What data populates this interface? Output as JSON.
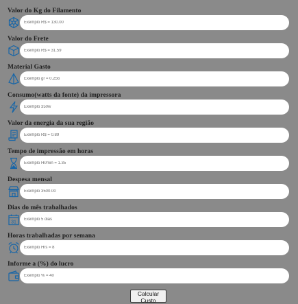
{
  "fields": [
    {
      "label": "Valor do Kg do Filamento",
      "placeholder": "Exemplo R$ = 130.00",
      "icon": "cube-network-icon"
    },
    {
      "label": "Valor do Frete",
      "placeholder": "Exemplo R$ = 31.59",
      "icon": "box-icon"
    },
    {
      "label": "Material Gasto",
      "placeholder": "Exemplo gr = 0.256",
      "icon": "pyramid-icon"
    },
    {
      "label": "Consumo(watts da fonte) da impressora",
      "placeholder": "Exemplo 350w",
      "icon": "lightning-icon"
    },
    {
      "label": "Valor da energia da sua região",
      "placeholder": "Exemplo R$ = 0.89",
      "icon": "bill-icon"
    },
    {
      "label": "Tempo de impressão em horas",
      "placeholder": "Exemplo Hr/min = 1.35",
      "icon": "hourglass-icon"
    },
    {
      "label": "Despesa mensal",
      "placeholder": "Exemplo 3500.00",
      "icon": "store-icon"
    },
    {
      "label": "Dias do mês trabalhados",
      "placeholder": "Exemplo 5 dias",
      "icon": "calendar-icon"
    },
    {
      "label": "Horas trabalhadas por semana",
      "placeholder": "Exemplo Hrs = 8",
      "icon": "alarm-clock-icon"
    },
    {
      "label": "Informe a (%) do lucro",
      "placeholder": "Exemplo % = 40",
      "icon": "wallet-icon"
    }
  ],
  "button": {
    "label": "Calcular Custo"
  },
  "colors": {
    "background": "#8a8a8a",
    "icon": "#1565a8",
    "input": "#ffffff"
  }
}
